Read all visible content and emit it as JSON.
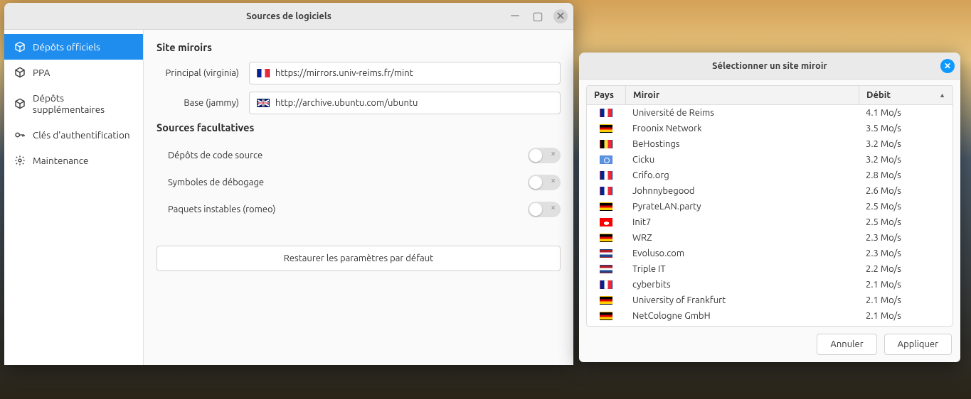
{
  "main": {
    "title": "Sources de logiciels",
    "sidebar": [
      {
        "label": "Dépôts officiels",
        "icon": "package",
        "active": true
      },
      {
        "label": "PPA",
        "icon": "package",
        "active": false
      },
      {
        "label": "Dépôts supplémentaires",
        "icon": "package",
        "active": false
      },
      {
        "label": "Clés d'authentification",
        "icon": "key",
        "active": false
      },
      {
        "label": "Maintenance",
        "icon": "gear",
        "active": false
      }
    ],
    "sections": {
      "mirrors_heading": "Site miroirs",
      "principal_label": "Principal (virginia)",
      "principal_value": "https://mirrors.univ-reims.fr/mint",
      "principal_flag": "fr",
      "base_label": "Base (jammy)",
      "base_value": "http://archive.ubuntu.com/ubuntu",
      "base_flag": "uk",
      "optional_heading": "Sources facultatives",
      "opts": [
        {
          "label": "Dépôts de code source",
          "on": false
        },
        {
          "label": "Symboles de débogage",
          "on": false
        },
        {
          "label": "Paquets instables (romeo)",
          "on": false
        }
      ],
      "restore_label": "Restaurer les paramètres par défaut"
    }
  },
  "dialog": {
    "title": "Sélectionner un site miroir",
    "columns": {
      "country": "Pays",
      "mirror": "Miroir",
      "speed": "Débit"
    },
    "rows": [
      {
        "flag": "fr",
        "name": "Université de Reims",
        "speed": "4.1 Mo/s"
      },
      {
        "flag": "de",
        "name": "Froonix Network",
        "speed": "3.5 Mo/s"
      },
      {
        "flag": "be",
        "name": "BeHostings",
        "speed": "3.2 Mo/s"
      },
      {
        "flag": "un",
        "name": "Cicku",
        "speed": "3.2 Mo/s"
      },
      {
        "flag": "fr",
        "name": "Crifo.org",
        "speed": "2.8 Mo/s"
      },
      {
        "flag": "fr",
        "name": "Johnnybegood",
        "speed": "2.6 Mo/s"
      },
      {
        "flag": "de",
        "name": "PyrateLAN.party",
        "speed": "2.5 Mo/s"
      },
      {
        "flag": "ch",
        "name": "Init7",
        "speed": "2.5 Mo/s"
      },
      {
        "flag": "de",
        "name": "WRZ",
        "speed": "2.3 Mo/s"
      },
      {
        "flag": "nl",
        "name": "Evoluso.com",
        "speed": "2.3 Mo/s"
      },
      {
        "flag": "nl",
        "name": "Triple IT",
        "speed": "2.2 Mo/s"
      },
      {
        "flag": "fr",
        "name": "cyberbits",
        "speed": "2.1 Mo/s"
      },
      {
        "flag": "de",
        "name": "University of Frankfurt",
        "speed": "2.1 Mo/s"
      },
      {
        "flag": "de",
        "name": "NetCologne GmbH",
        "speed": "2.1 Mo/s"
      }
    ],
    "cancel": "Annuler",
    "apply": "Appliquer"
  }
}
